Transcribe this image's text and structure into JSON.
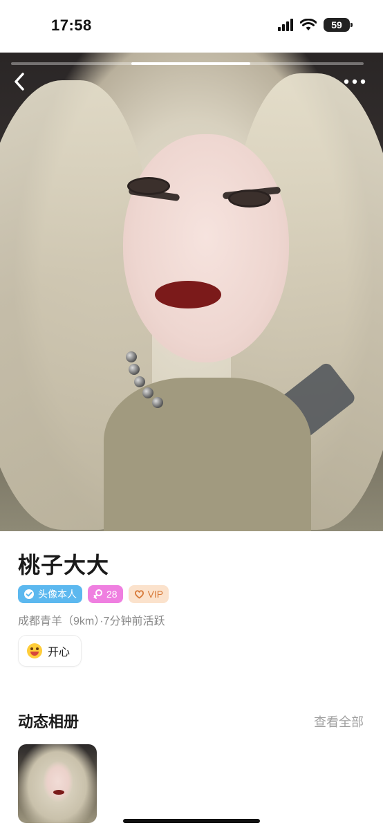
{
  "status_bar": {
    "time": "17:58",
    "battery": "59",
    "icons": [
      "signal-icon",
      "wifi-icon",
      "battery-icon"
    ]
  },
  "photo": {
    "page_indicator": {
      "current": 2,
      "total": 3
    },
    "icons": [
      "back-arrow-icon",
      "more-dots-icon"
    ]
  },
  "profile": {
    "name": "桃子大大",
    "tags": {
      "verified": "头像本人",
      "age": "28",
      "vip": "VIP"
    },
    "meta": "成都青羊（9km）·7分钟前活跃",
    "mood": "开心"
  },
  "album": {
    "title": "动态相册",
    "view_all": "查看全部"
  },
  "colors": {
    "verified_tag": "#5cb8ef",
    "age_tag": "#ef7fe0",
    "vip_tag_bg": "#fbe2cc",
    "vip_tag_text": "#d77a3a",
    "secondary_text": "#8a8a8a"
  }
}
